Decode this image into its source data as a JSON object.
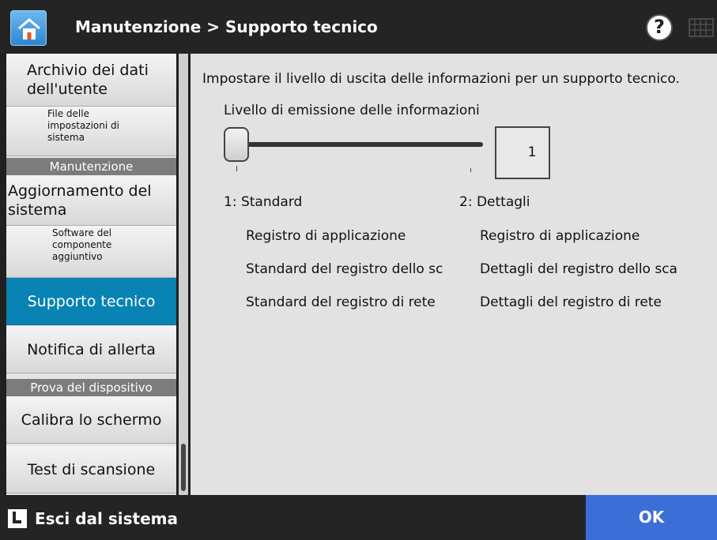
{
  "header": {
    "title": "Manutenzione > Supporto tecnico",
    "home_icon": "home-icon",
    "help_label": "?",
    "keyboard_icon": "keyboard-icon"
  },
  "sidebar": {
    "items": [
      {
        "label": "Archivio dei dati dell'utente"
      },
      {
        "label": "File delle impostazioni di sistema"
      },
      {
        "label": "Manutenzione"
      },
      {
        "label": "Aggiornamento del sistema"
      },
      {
        "label": "Software del componente aggiuntivo"
      },
      {
        "label": "Supporto tecnico"
      },
      {
        "label": "Notifica di allerta"
      },
      {
        "label": "Prova del dispositivo"
      },
      {
        "label": "Calibra lo schermo"
      },
      {
        "label": "Test di scansione"
      }
    ]
  },
  "main": {
    "description": "Impostare il livello di uscita delle informazioni per un supporto tecnico.",
    "slider_label": "Livello di emissione delle informazioni",
    "slider_value": "1",
    "slider_level_fraction": 0,
    "level1": {
      "title": "1: Standard",
      "items": [
        "Registro di applicazione",
        "Standard del registro dello sc",
        "Standard del registro di rete"
      ]
    },
    "level2": {
      "title": "2: Dettagli",
      "items": [
        "Registro di applicazione",
        "Dettagli del registro dello sca",
        "Dettagli del registro di rete"
      ]
    }
  },
  "footer": {
    "logout_label": "Esci dal sistema",
    "logout_icon": "logout-icon",
    "ok_label": "OK"
  },
  "colors": {
    "active": "#0883b4",
    "ok": "#3b6fd7",
    "bar": "#242424"
  }
}
